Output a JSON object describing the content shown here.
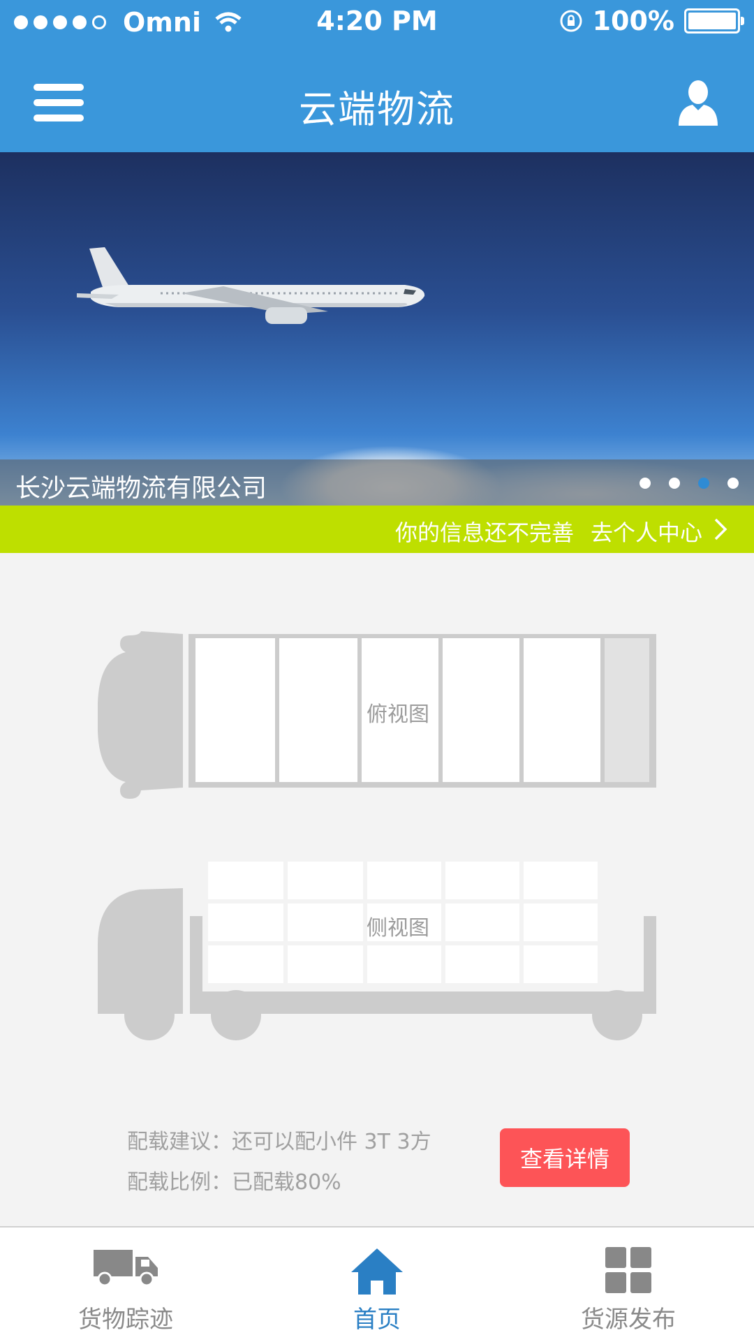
{
  "status_bar": {
    "carrier": "Omni",
    "time": "4:20 PM",
    "battery": "100%"
  },
  "header": {
    "title": "云端物流"
  },
  "banner": {
    "caption": "长沙云端物流有限公司",
    "pages": 4,
    "active_page": 3
  },
  "notice": {
    "message": "你的信息还不完善",
    "link": "去个人中心"
  },
  "truck": {
    "top_view_label": "俯视图",
    "side_view_label": "侧视图"
  },
  "load_info": {
    "suggestion": "配载建议：还可以配小件 3T 3方",
    "ratio": "配载比例：已配载80%",
    "detail_button": "查看详情"
  },
  "tabbar": {
    "tabs": [
      {
        "label": "货物踪迹",
        "icon": "truck-icon"
      },
      {
        "label": "首页",
        "icon": "home-icon"
      },
      {
        "label": "货源发布",
        "icon": "grid-icon"
      }
    ],
    "active_index": 1
  },
  "colors": {
    "header_blue": "#3a97db",
    "notice_green": "#bedf00",
    "button_red": "#fd5457",
    "active_tab": "#2a7fc4"
  }
}
